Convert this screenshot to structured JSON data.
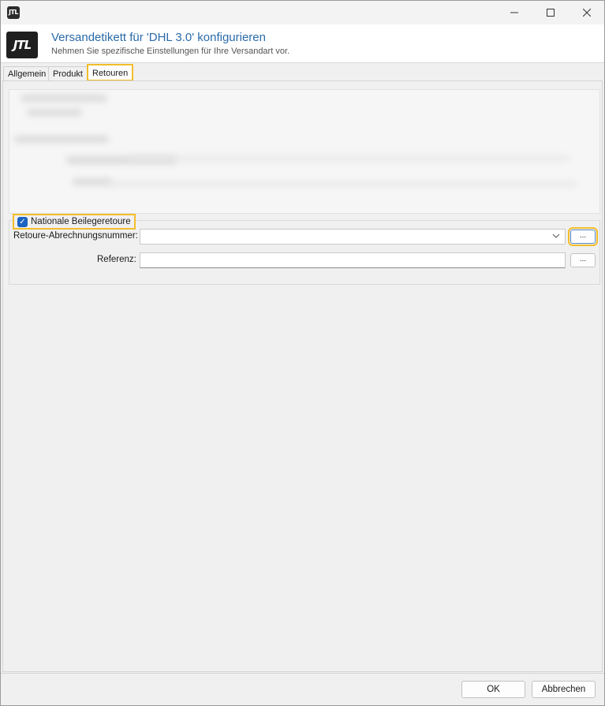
{
  "window": {
    "app_icon_text": "JTL",
    "controls": {
      "minimize_icon": "minimize-icon",
      "maximize_icon": "maximize-icon",
      "close_icon": "close-icon"
    }
  },
  "header": {
    "logo_text": "JTL",
    "title": "Versandetikett für 'DHL 3.0' konfigurieren",
    "subtitle": "Nehmen Sie spezifische Einstellungen für Ihre Versandart vor."
  },
  "tabs": [
    {
      "label": "Allgemein",
      "active": false
    },
    {
      "label": "Produkt",
      "active": false
    },
    {
      "label": "Retouren",
      "active": true
    }
  ],
  "retouren": {
    "group": {
      "label": "Nationale Beilegeretoure",
      "checked": true
    },
    "abrechnungsnummer": {
      "label": "Retoure-Abrechnungsnummer:",
      "value": "",
      "browse_label": "..."
    },
    "referenz": {
      "label": "Referenz:",
      "value": "",
      "browse_label": "..."
    }
  },
  "footer": {
    "ok_label": "OK",
    "cancel_label": "Abbrechen"
  },
  "colors": {
    "accent_title": "#2a6aa8",
    "highlight": "#f2bd2c",
    "checkbox": "#1d63c2"
  }
}
